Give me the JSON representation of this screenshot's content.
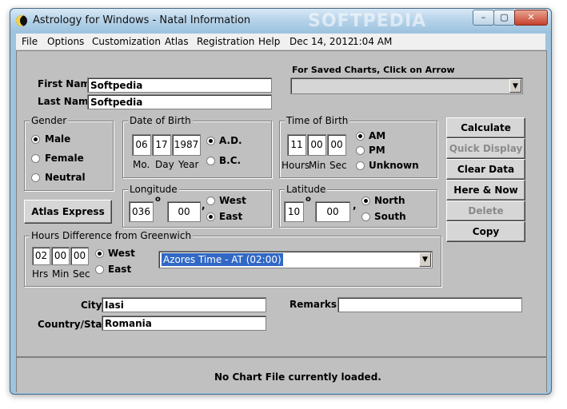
{
  "window": {
    "title": "Astrology for Windows - Natal Information",
    "watermark": "SOFTPEDIA",
    "controls": {
      "minimize": "–",
      "maximize": "▢",
      "close": "✕"
    }
  },
  "menu": {
    "items": [
      "File",
      "Options",
      "Customization",
      "Atlas",
      "Registration",
      "Help"
    ],
    "date": "Dec 14, 2012",
    "time": "1:04 AM"
  },
  "name": {
    "first_label": "First Name",
    "first_value": "Softpedia",
    "last_label": "Last Name",
    "last_value": "Softpedia"
  },
  "saved_charts": {
    "label": "For Saved Charts, Click on Arrow",
    "value": ""
  },
  "gender": {
    "title": "Gender",
    "options": [
      "Male",
      "Female",
      "Neutral"
    ],
    "selected": "Male"
  },
  "dob": {
    "title": "Date of Birth",
    "mo": "06",
    "day": "17",
    "year": "1987",
    "mo_label": "Mo.",
    "day_label": "Day",
    "year_label": "Year",
    "era_options": [
      "A.D.",
      "B.C."
    ],
    "era_selected": "A.D."
  },
  "tob": {
    "title": "Time of Birth",
    "hours": "11",
    "min": "00",
    "sec": "00",
    "hours_label": "Hours",
    "min_label": "Min",
    "sec_label": "Sec",
    "options": [
      "AM",
      "PM",
      "Unknown"
    ],
    "selected": "AM"
  },
  "buttons": {
    "calculate": "Calculate",
    "quick_display": "Quick Display",
    "clear_data": "Clear Data",
    "here_now": "Here & Now",
    "delete": "Delete",
    "copy": "Copy",
    "atlas_express": "Atlas Express"
  },
  "longitude": {
    "title": "Longitude",
    "deg": "036",
    "min": "00",
    "deg_symbol": "o",
    "sep": ",",
    "options": [
      "West",
      "East"
    ],
    "selected": "East"
  },
  "latitude": {
    "title": "Latitude",
    "deg": "10",
    "min": "00",
    "deg_symbol": "o",
    "sep": ",",
    "options": [
      "North",
      "South"
    ],
    "selected": "North"
  },
  "greenwich": {
    "title": "Hours Difference from Greenwich",
    "hrs": "02",
    "min": "00",
    "sec": "00",
    "hrs_label": "Hrs",
    "min_label": "Min",
    "sec_label": "Sec",
    "options": [
      "West",
      "East"
    ],
    "selected": "West",
    "timezone": "Azores Time - AT (02:00)"
  },
  "location": {
    "city_label": "City",
    "city_value": "Iasi",
    "country_label": "Country/State",
    "country_value": "Romania",
    "remarks_label": "Remarks",
    "remarks_value": ""
  },
  "status": {
    "text": "No Chart File currently loaded."
  }
}
